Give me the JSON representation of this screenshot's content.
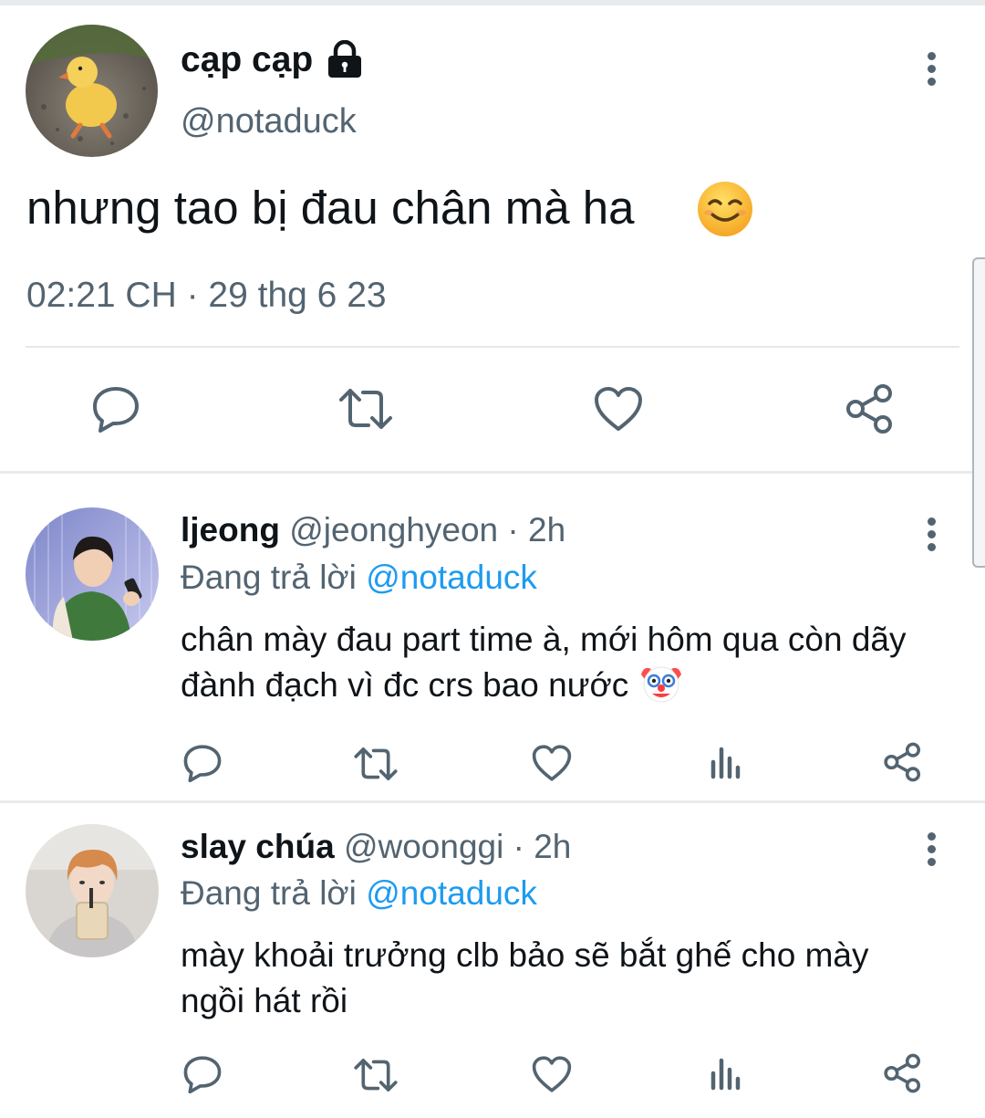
{
  "tweet": {
    "display_name": "cạp cạp",
    "handle": "@notaduck",
    "text": "nhưng tao bị đau chân mà ha",
    "emoji": "smiling-face-icon",
    "timestamp": "02:21 CH · 29 thg 6 23"
  },
  "replies": [
    {
      "display_name": "ljeong",
      "handle": "@jeonghyeon",
      "age": "· 2h",
      "replying_prefix": "Đang trả lời",
      "replying_to": "@notaduck",
      "text": "chân mày đau part time à, mới hôm qua còn dãy đành đạch vì đc crs bao nước",
      "emoji": "clown-face-icon"
    },
    {
      "display_name": "slay chúa",
      "handle": "@woonggi",
      "age": "· 2h",
      "replying_prefix": "Đang trả lời",
      "replying_to": "@notaduck",
      "text": "mày khoải trưởng clb bảo sẽ bắt ghế cho mày ngồi hát rồi"
    }
  ],
  "colors": {
    "text_primary": "#0f1419",
    "text_secondary": "#536471",
    "mention": "#1d9bf0",
    "divider": "#e4e8eb"
  }
}
